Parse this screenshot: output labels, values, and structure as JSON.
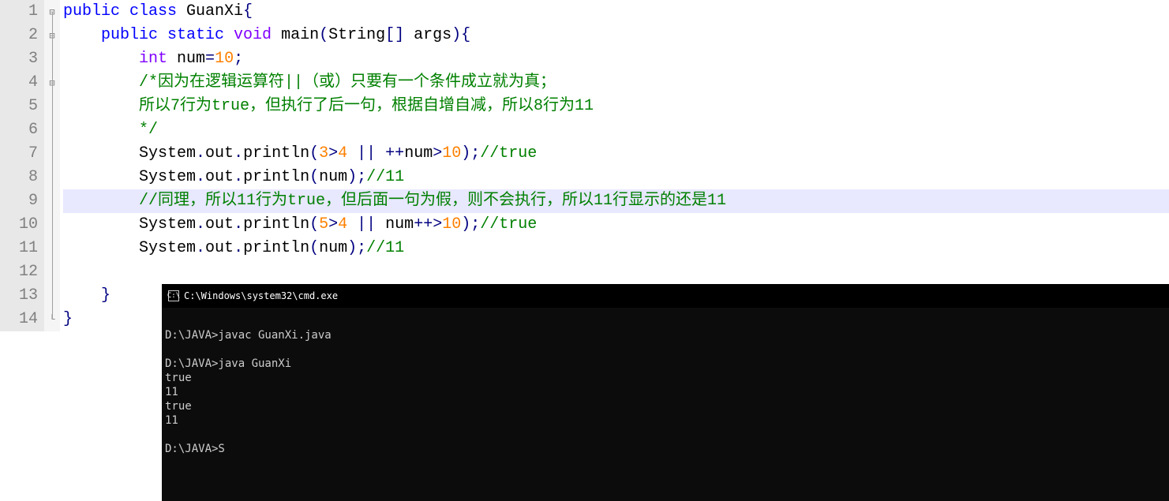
{
  "editor": {
    "lines": [
      "1",
      "2",
      "3",
      "4",
      "5",
      "6",
      "7",
      "8",
      "9",
      "10",
      "11",
      "12",
      "13",
      "14"
    ],
    "highlighted_line": 9,
    "code": {
      "l1": {
        "t1": "public",
        "t2": " class ",
        "t3": "GuanXi",
        "t4": "{"
      },
      "l2": {
        "t1": "    ",
        "t2": "public",
        "t3": " static ",
        "t4": "void",
        "t5": " main",
        "t6": "(",
        "t7": "String",
        "t8": "[]",
        "t9": " args",
        "t10": ")",
        "t11": "{"
      },
      "l3": {
        "t1": "        ",
        "t2": "int",
        "t3": " num",
        "t4": "=",
        "t5": "10",
        "t6": ";"
      },
      "l4": {
        "t1": "        ",
        "t2": "/*因为在逻辑运算符||（或）只要有一个条件成立就为真；"
      },
      "l5": {
        "t1": "        ",
        "t2": "所以7行为true，但执行了后一句，根据自增自减，所以8行为11"
      },
      "l6": {
        "t1": "        ",
        "t2": "*/"
      },
      "l7": {
        "t1": "        System",
        "t2": ".",
        "t3": "out",
        "t4": ".",
        "t5": "println",
        "t6": "(",
        "t7": "3",
        "t8": ">",
        "t9": "4",
        "t10": " || ",
        "t11": "++",
        "t12": "num",
        "t13": ">",
        "t14": "10",
        "t15": ")",
        "t16": ";",
        "t17": "//true"
      },
      "l8": {
        "t1": "        System",
        "t2": ".",
        "t3": "out",
        "t4": ".",
        "t5": "println",
        "t6": "(",
        "t7": "num",
        "t8": ")",
        "t9": ";",
        "t10": "//11"
      },
      "l9": {
        "t1": "        ",
        "t2": "//同理，所以11行为true，但后面一句为假，则不会执行，所以11行显示的还是11"
      },
      "l10": {
        "t1": "        System",
        "t2": ".",
        "t3": "out",
        "t4": ".",
        "t5": "println",
        "t6": "(",
        "t7": "5",
        "t8": ">",
        "t9": "4",
        "t10": " || ",
        "t11": "num",
        "t12": "++>",
        "t13": "10",
        "t14": ")",
        "t15": ";",
        "t16": "//true"
      },
      "l11": {
        "t1": "        System",
        "t2": ".",
        "t3": "out",
        "t4": ".",
        "t5": "println",
        "t6": "(",
        "t7": "num",
        "t8": ")",
        "t9": ";",
        "t10": "//11"
      },
      "l12": {
        "t1": ""
      },
      "l13": {
        "t1": "    ",
        "t2": "}"
      },
      "l14": {
        "t1": "}"
      }
    }
  },
  "terminal": {
    "title": "C:\\Windows\\system32\\cmd.exe",
    "body": "\nD:\\JAVA>javac GuanXi.java\n\nD:\\JAVA>java GuanXi\ntrue\n11\ntrue\n11\n\nD:\\JAVA>S"
  }
}
